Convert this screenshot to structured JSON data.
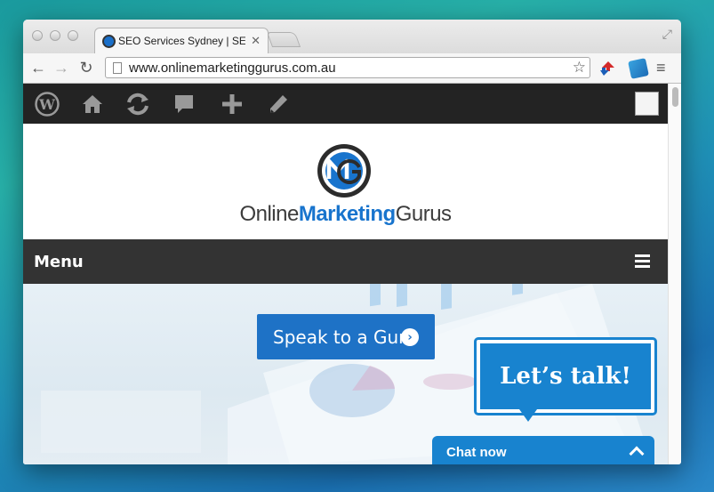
{
  "browser": {
    "tab_title": "SEO Services Sydney | SEO",
    "url": "www.onlinemarketinggurus.com.au"
  },
  "wp_admin_bar": {
    "icons": [
      "wordpress-icon",
      "home-icon",
      "refresh-icon",
      "comment-icon",
      "plus-icon",
      "pencil-icon"
    ]
  },
  "site": {
    "logo_part1": "Online",
    "logo_part2": "Marketing",
    "logo_part3": "Gurus",
    "menu_label": "Menu",
    "hero_button": "Speak to a Guru",
    "talk_bubble": "Let’s talk!",
    "chat_now": "Chat now"
  },
  "colors": {
    "brand_blue": "#1e72c6",
    "admin_bar": "#232323",
    "menu_bar": "#333333"
  }
}
